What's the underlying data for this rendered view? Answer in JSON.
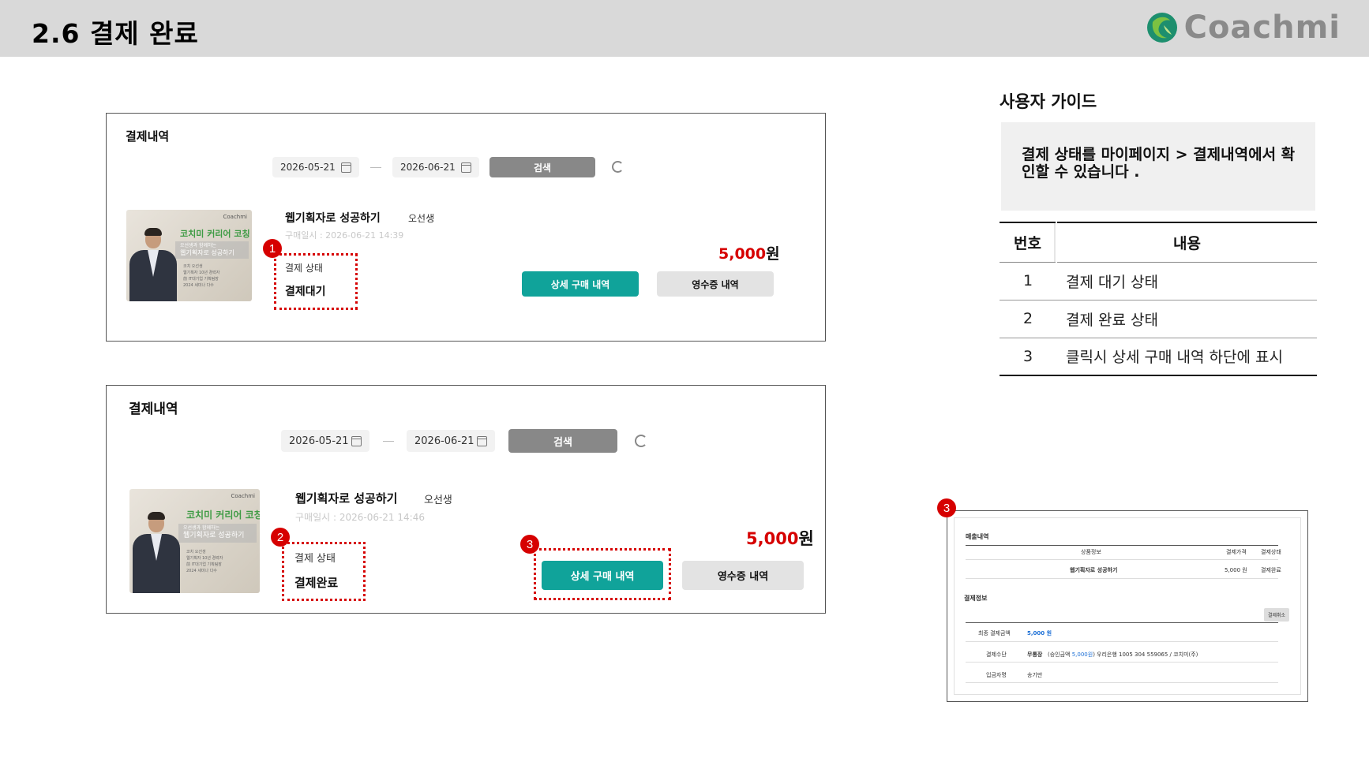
{
  "header": {
    "title": "2.6  결제 완료",
    "logo_text": "Coachmi",
    "background": "#d9d9d9"
  },
  "panels": [
    {
      "title": "결제내역",
      "date_from": "2026-05-21",
      "date_to": "2026-06-21",
      "search_label": "검색",
      "thumbnail": {
        "logo": "Coachmi",
        "title": "코치미 커리어 코칭",
        "band_line1": "오선생과 함께하는",
        "band_line2": "웹기획자로 성공하기",
        "small1": "코치 오선생",
        "small2": "웹기획자 10년 경력자",
        "small3": "前 IT대기업 기획팀장",
        "small4": "2024 세미나 다수"
      },
      "product_name": "웹기획자로 성공하기",
      "instructor": "오선생",
      "purchase_date": "구매일시 : 2026-06-21 14:39",
      "price": "5,000",
      "price_unit": "원",
      "status_label": "결제 상태",
      "status_value": "결제대기",
      "detail_label": "상세 구매 내역",
      "receipt_label": "영수증 내역",
      "badge": "1"
    },
    {
      "title": "결제내역",
      "date_from": "2026-05-21",
      "date_to": "2026-06-21",
      "search_label": "검색",
      "thumbnail": {
        "logo": "Coachmi",
        "title": "코치미 커리어 코칭",
        "band_line1": "오선생과 함께하는",
        "band_line2": "웹기획자로 성공하기",
        "small1": "코치 오선생",
        "small2": "웹기획자 10년 경력자",
        "small3": "前 IT대기업 기획팀장",
        "small4": "2024 세미나 다수"
      },
      "product_name": "웹기획자로 성공하기",
      "instructor": "오선생",
      "purchase_date": "구매일시 : 2026-06-21 14:46",
      "price": "5,000",
      "price_unit": "원",
      "status_label": "결제 상태",
      "status_value": "결제완료",
      "detail_label": "상세 구매 내역",
      "receipt_label": "영수증 내역",
      "badge_status": "2",
      "badge_detail": "3"
    }
  ],
  "guide": {
    "heading": "사용자 가이드",
    "message": "결제 상태를 마이페이지  >  결제내역에서 확인할 수 있습니다 .",
    "columns": [
      "번호",
      "내용"
    ],
    "rows": [
      {
        "no": "1",
        "content": "결제 대기 상태"
      },
      {
        "no": "2",
        "content": "결제 완료 상태"
      },
      {
        "no": "3",
        "content": "클릭시 상세 구매 내역 하단에 표시"
      }
    ]
  },
  "preview": {
    "badge": "3",
    "sales_title": "매출내역",
    "col_product": "상품정보",
    "col_price": "결제가격",
    "col_status": "결제상태",
    "row_product": "웹기획자로 성공하기",
    "row_price": "5,000 원",
    "row_status": "결제완료",
    "payment_title": "결제정보",
    "cancel_label": "결제취소",
    "final_label": "최종 결제금액",
    "final_value": "5,000 원",
    "method_label": "결제수단",
    "method_value": "무통장",
    "method_amount_prefix": "(승인금액 ",
    "method_amount": "5,000원",
    "method_amount_suffix": ")",
    "method_account": "우리은행 1005 304 559065 / 코치미(주)",
    "depositor_label": "입금자명",
    "depositor_value": "송기만"
  },
  "colors": {
    "accent_teal": "#10a39a",
    "highlight_red": "#d60000",
    "search_gray": "#888888"
  }
}
